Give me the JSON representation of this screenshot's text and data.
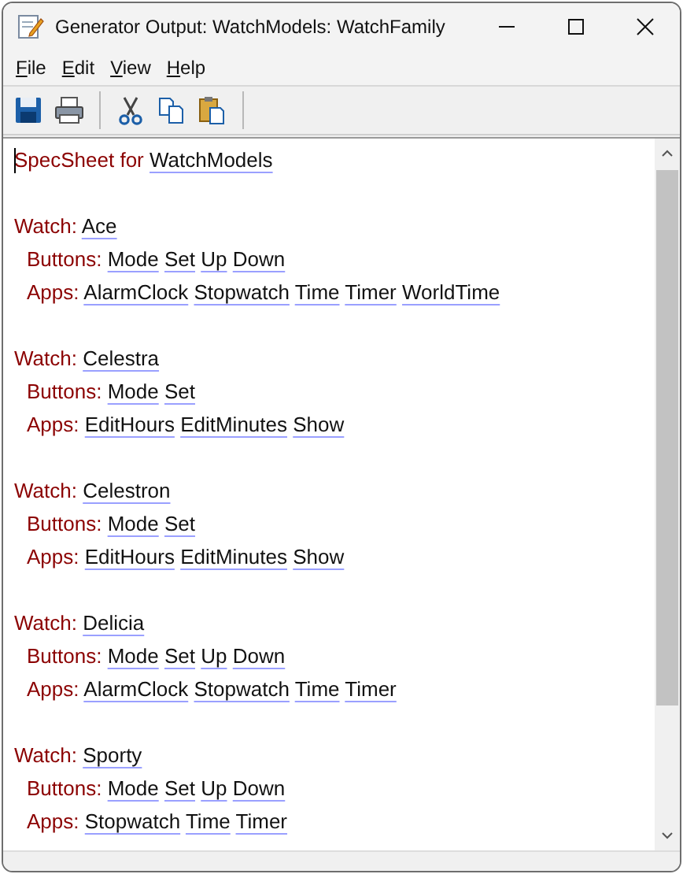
{
  "window": {
    "title": "Generator Output: WatchModels: WatchFamily"
  },
  "menu": [
    "File",
    "Edit",
    "View",
    "Help"
  ],
  "toolbar": [
    {
      "kind": "save"
    },
    {
      "kind": "print"
    },
    {
      "kind": "separator"
    },
    {
      "kind": "cut"
    },
    {
      "kind": "copy"
    },
    {
      "kind": "paste"
    },
    {
      "kind": "separator"
    }
  ],
  "document": {
    "heading": {
      "label": "SpecSheet for",
      "link": "WatchModels"
    },
    "watches": [
      {
        "label": "Watch:",
        "name": "Ace",
        "rows": [
          {
            "label": "Buttons:",
            "items": [
              "Mode",
              "Set",
              "Up",
              "Down"
            ]
          },
          {
            "label": "Apps:",
            "items": [
              "AlarmClock",
              "Stopwatch",
              "Time",
              "Timer",
              "WorldTime"
            ]
          }
        ]
      },
      {
        "label": "Watch:",
        "name": "Celestra",
        "rows": [
          {
            "label": "Buttons:",
            "items": [
              "Mode",
              "Set"
            ]
          },
          {
            "label": "Apps:",
            "items": [
              "EditHours",
              "EditMinutes",
              "Show"
            ]
          }
        ]
      },
      {
        "label": "Watch:",
        "name": "Celestron",
        "rows": [
          {
            "label": "Buttons:",
            "items": [
              "Mode",
              "Set"
            ]
          },
          {
            "label": "Apps:",
            "items": [
              "EditHours",
              "EditMinutes",
              "Show"
            ]
          }
        ]
      },
      {
        "label": "Watch:",
        "name": "Delicia",
        "rows": [
          {
            "label": "Buttons:",
            "items": [
              "Mode",
              "Set",
              "Up",
              "Down"
            ]
          },
          {
            "label": "Apps:",
            "items": [
              "AlarmClock",
              "Stopwatch",
              "Time",
              "Timer"
            ]
          }
        ]
      },
      {
        "label": "Watch:",
        "name": "Sporty",
        "rows": [
          {
            "label": "Buttons:",
            "items": [
              "Mode",
              "Set",
              "Up",
              "Down"
            ]
          },
          {
            "label": "Apps:",
            "items": [
              "Stopwatch",
              "Time",
              "Timer"
            ]
          }
        ]
      }
    ]
  }
}
